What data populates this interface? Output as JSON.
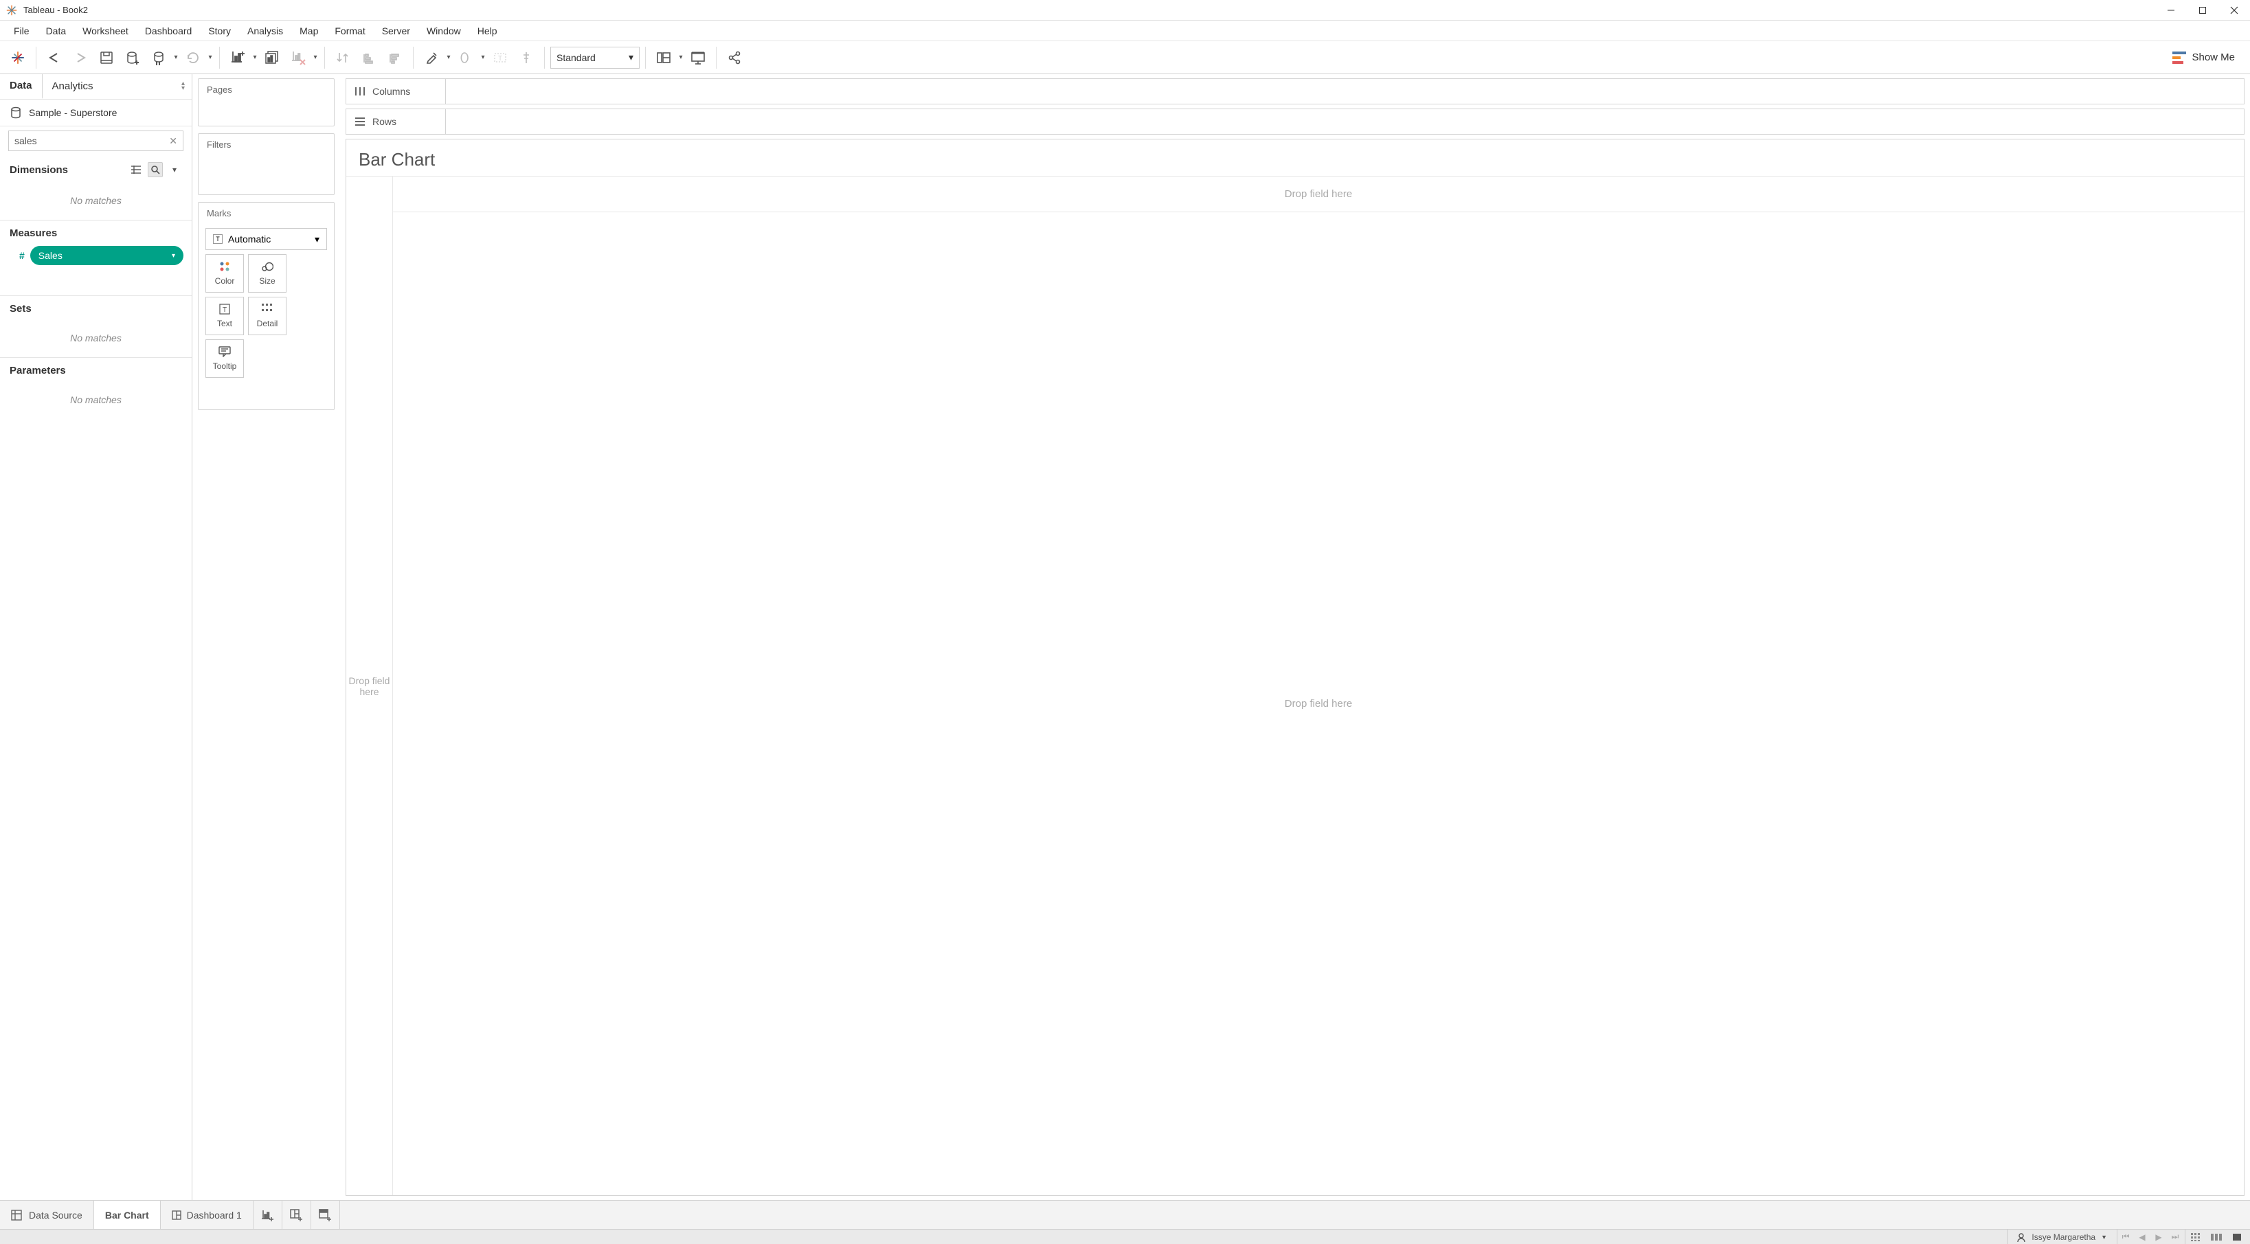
{
  "window": {
    "title": "Tableau - Book2"
  },
  "menu": {
    "file": "File",
    "data": "Data",
    "worksheet": "Worksheet",
    "dashboard": "Dashboard",
    "story": "Story",
    "analysis": "Analysis",
    "map": "Map",
    "format": "Format",
    "server": "Server",
    "window": "Window",
    "help": "Help"
  },
  "toolbar": {
    "fit": "Standard",
    "showme": "Show Me"
  },
  "data_panel": {
    "tab_data": "Data",
    "tab_analytics": "Analytics",
    "datasource": "Sample - Superstore",
    "search_value": "sales",
    "dimensions_label": "Dimensions",
    "dimensions_nomatch": "No matches",
    "measures_label": "Measures",
    "measures_field": "Sales",
    "sets_label": "Sets",
    "sets_nomatch": "No matches",
    "parameters_label": "Parameters",
    "parameters_nomatch": "No matches"
  },
  "cards": {
    "pages": "Pages",
    "filters": "Filters",
    "marks": "Marks",
    "marks_type": "Automatic",
    "color": "Color",
    "size": "Size",
    "text": "Text",
    "detail": "Detail",
    "tooltip": "Tooltip"
  },
  "shelves": {
    "columns": "Columns",
    "rows": "Rows"
  },
  "viz": {
    "title": "Bar Chart",
    "drop_rows": "Drop field here",
    "drop_cols": "Drop field here",
    "drop_main": "Drop field here"
  },
  "tabs": {
    "datasource": "Data Source",
    "sheet1": "Bar Chart",
    "dashboard1": "Dashboard 1"
  },
  "status": {
    "user": "Issye Margaretha"
  }
}
